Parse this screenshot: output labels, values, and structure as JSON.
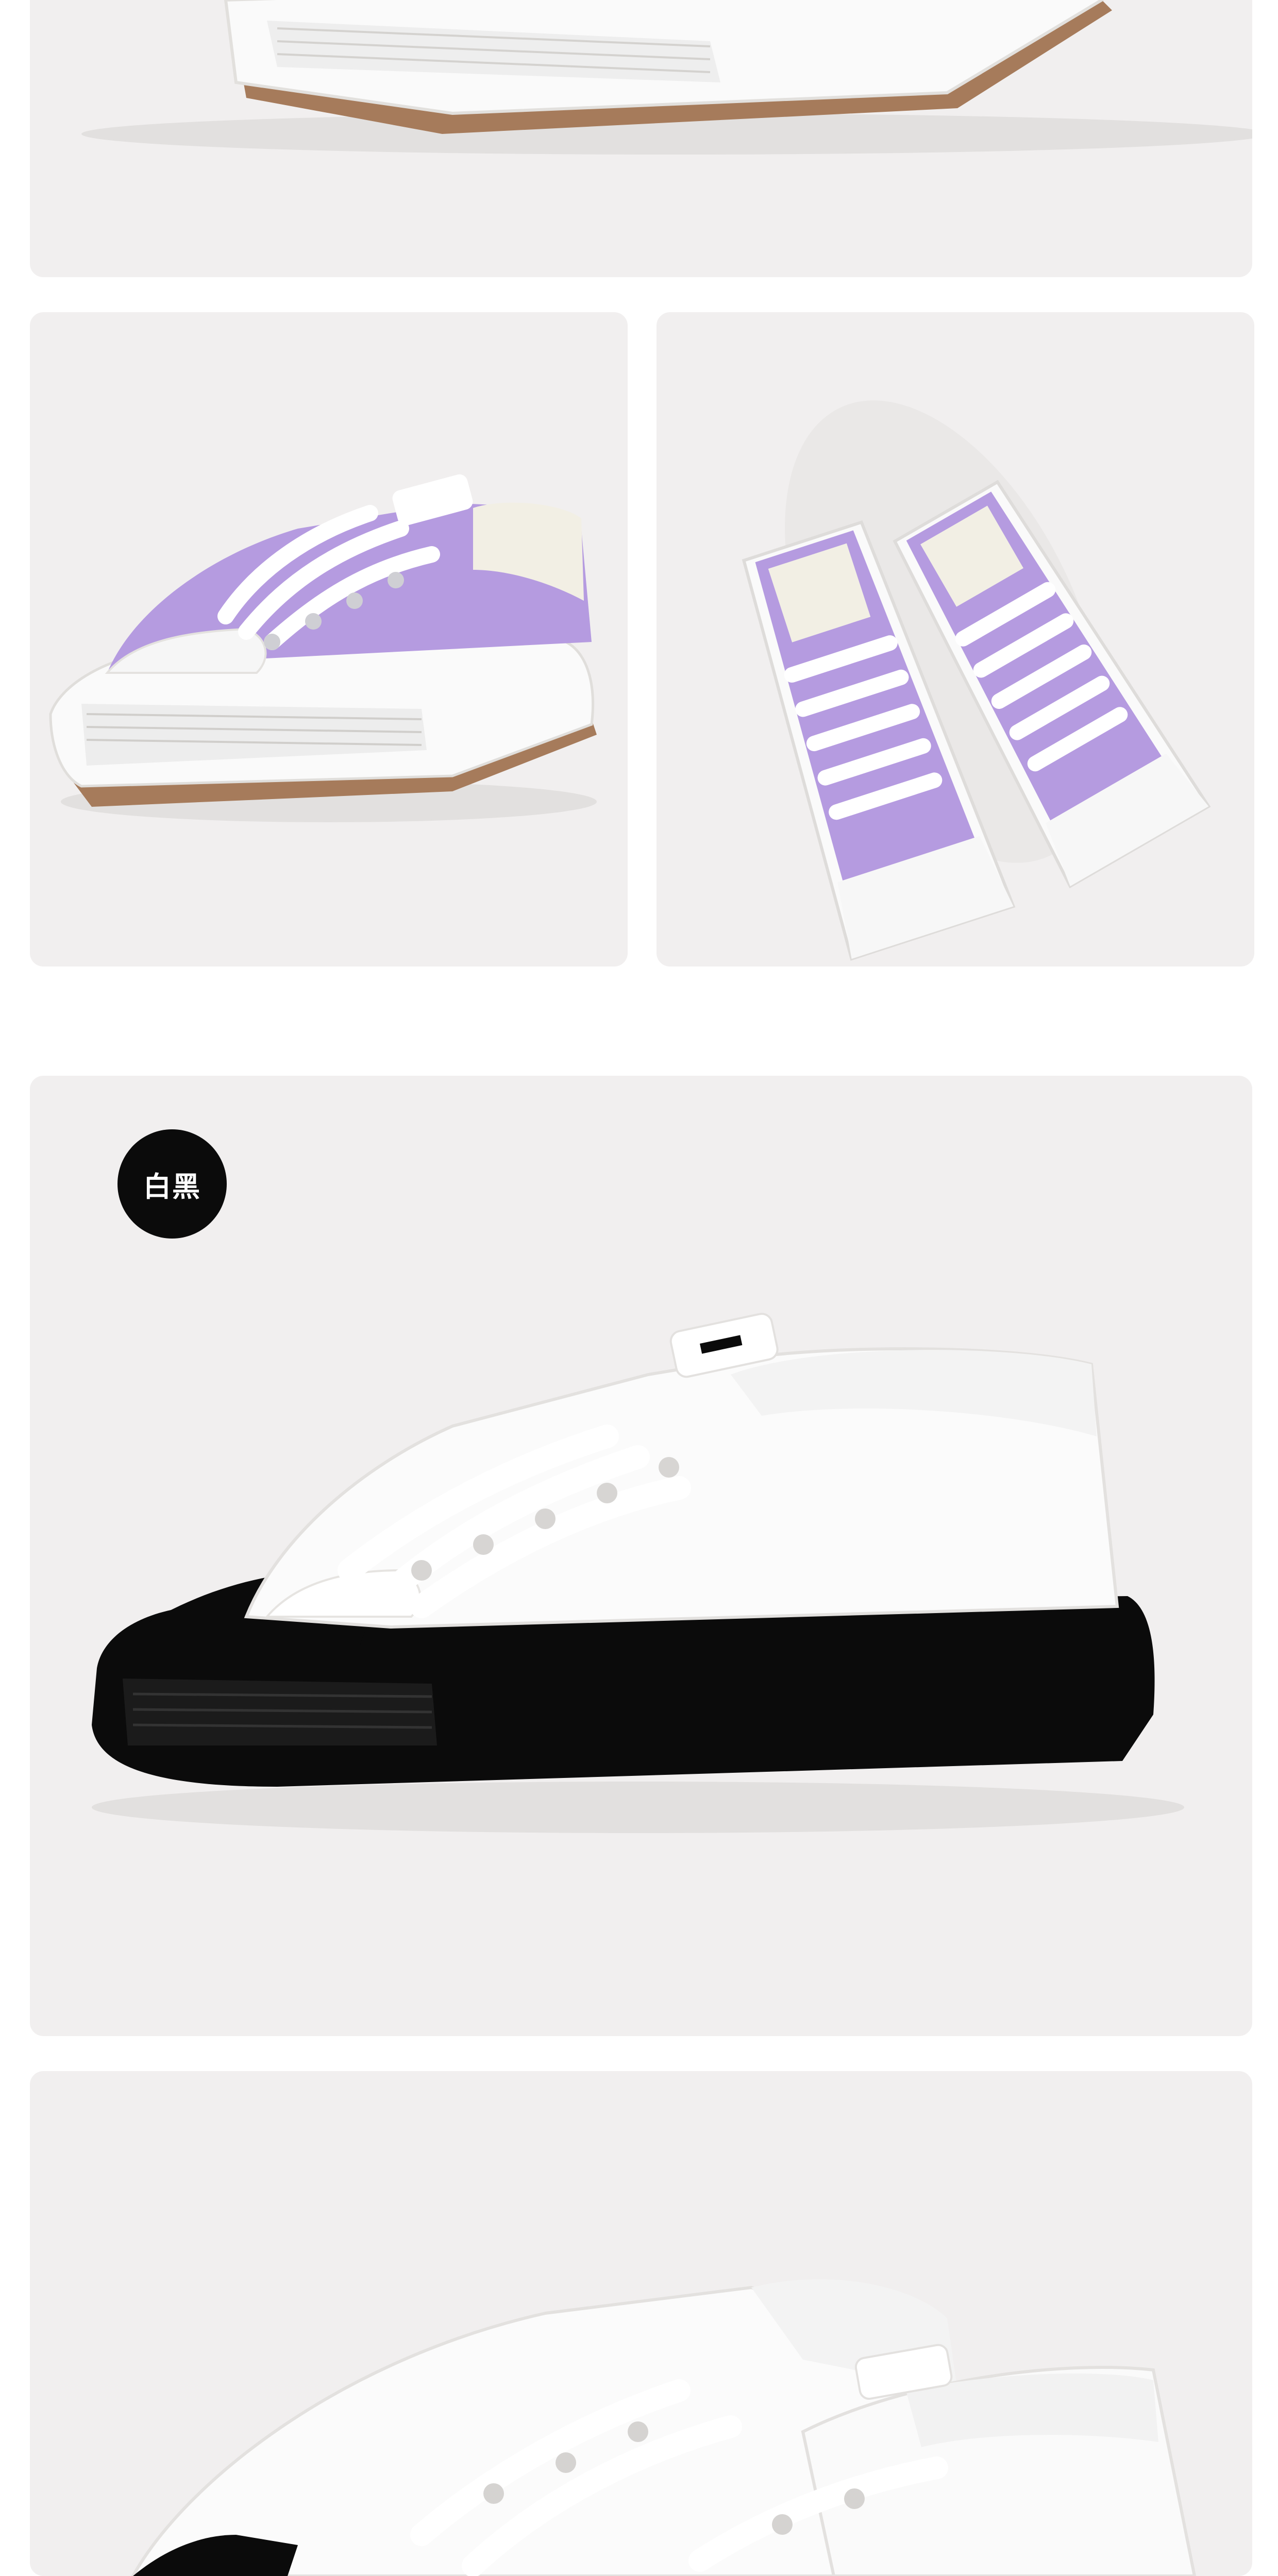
{
  "gallery": {
    "items": [
      {
        "name": "top-shoe-sole-closeup",
        "icon": "sneaker-sole-image"
      },
      {
        "name": "purple-shoe-side",
        "icon": "purple-sneaker-image"
      },
      {
        "name": "purple-shoe-pair",
        "icon": "purple-sneaker-pair-image"
      },
      {
        "name": "white-black-shoe-side",
        "icon": "white-black-sneaker-image"
      },
      {
        "name": "white-shoe-pair",
        "icon": "white-sneaker-pair-image"
      }
    ],
    "color_badge_label": "白黑"
  },
  "colors": {
    "card_bg": "#f1efef",
    "purple_canvas": "#b59be0",
    "black_sole": "#0b0b0b",
    "gum_sole": "#a67b5b",
    "white_canvas": "#fbfbfb"
  }
}
